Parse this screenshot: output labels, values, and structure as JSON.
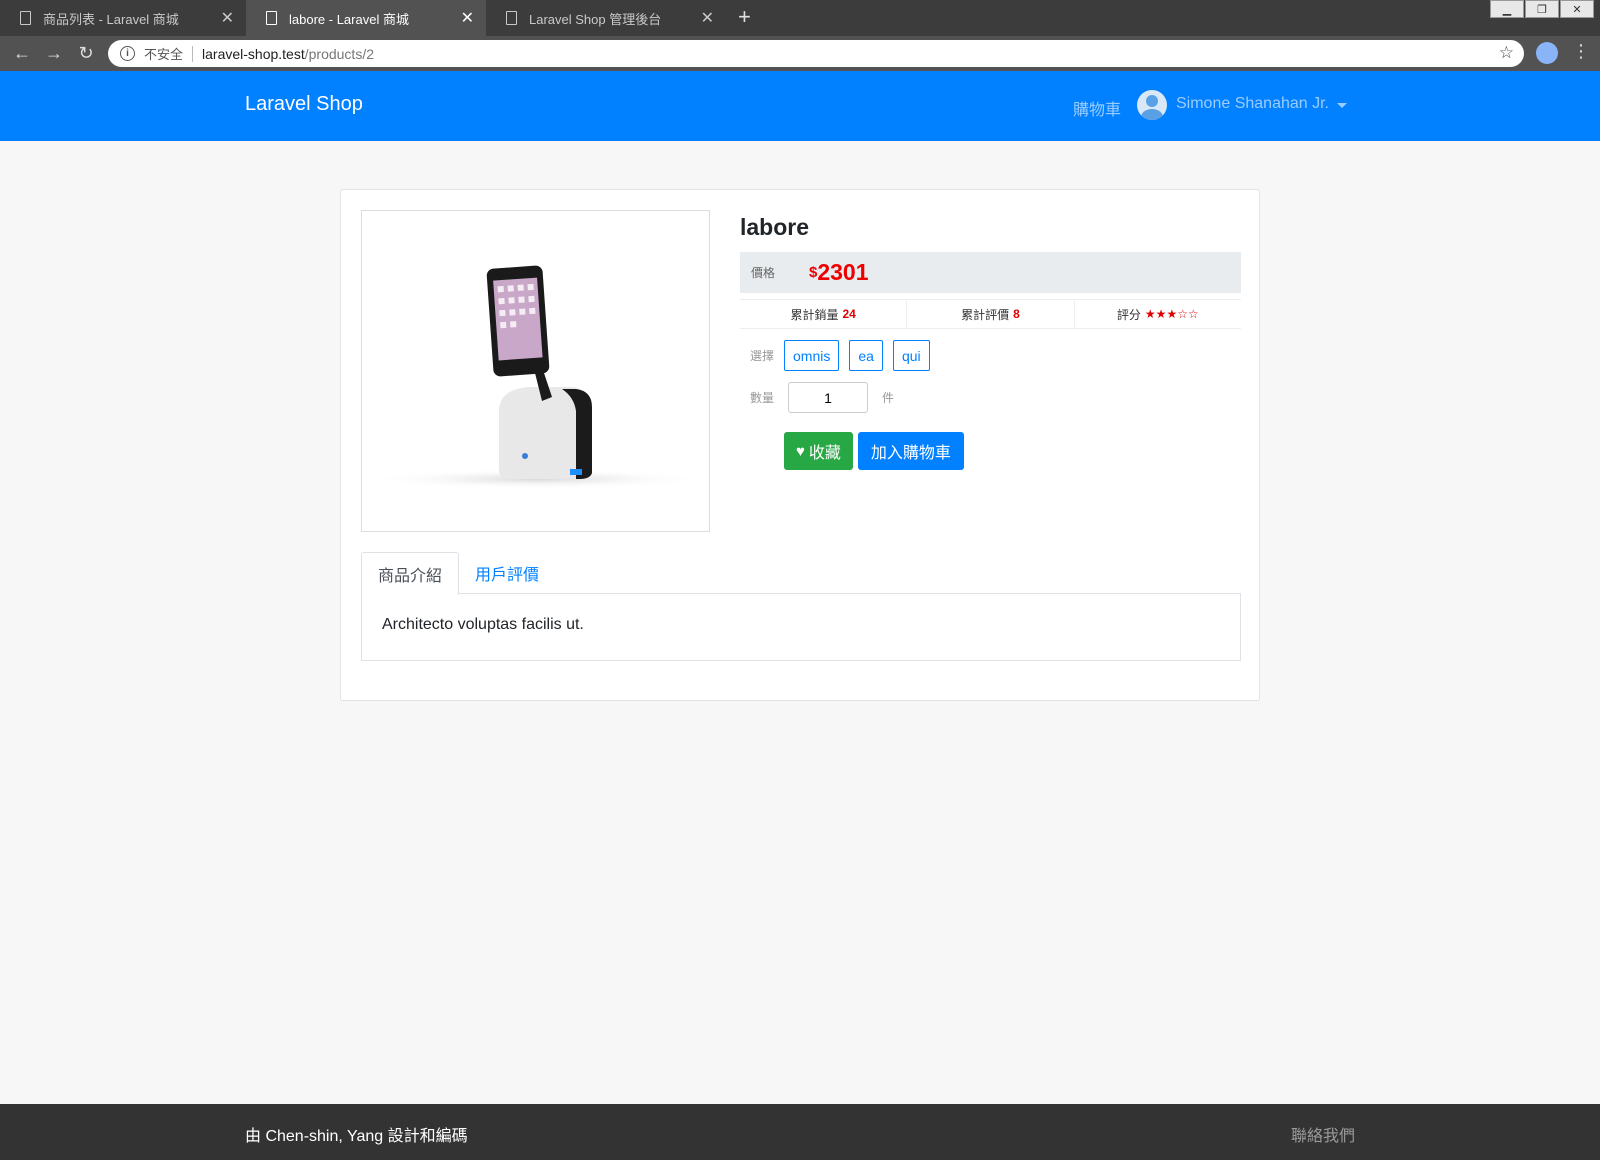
{
  "browser": {
    "tabs": [
      {
        "title": "商品列表 - Laravel 商城",
        "active": false
      },
      {
        "title": "labore - Laravel 商城",
        "active": true
      },
      {
        "title": "Laravel Shop 管理後台",
        "active": false
      }
    ],
    "security_label": "不安全",
    "url_host": "laravel-shop.test",
    "url_path": "/products/2"
  },
  "navbar": {
    "brand": "Laravel Shop",
    "cart_label": "購物車",
    "user_name": "Simone Shanahan Jr.",
    "color": "#0180ff"
  },
  "product": {
    "title": "labore",
    "price_label": "價格",
    "price_symbol": "$",
    "price": "2301",
    "sold_label": "累計銷量",
    "sold_count": "24",
    "review_label": "累計評價",
    "review_count": "8",
    "rating_label": "評分",
    "rating_stars": "★★★☆☆",
    "rating_value": 3,
    "rating_max": 5,
    "sku_label": "選擇",
    "skus": [
      "omnis",
      "ea",
      "qui"
    ],
    "qty_label": "數量",
    "qty_value": "1",
    "qty_unit": "件",
    "fav_button": "收藏",
    "cart_button": "加入購物車"
  },
  "detail_tabs": {
    "description_tab": "商品介紹",
    "reviews_tab": "用戶評價",
    "description": "Architecto voluptas facilis ut."
  },
  "footer": {
    "credit": "由 Chen-shin, Yang 設計和編碼",
    "contact": "聯絡我們"
  }
}
